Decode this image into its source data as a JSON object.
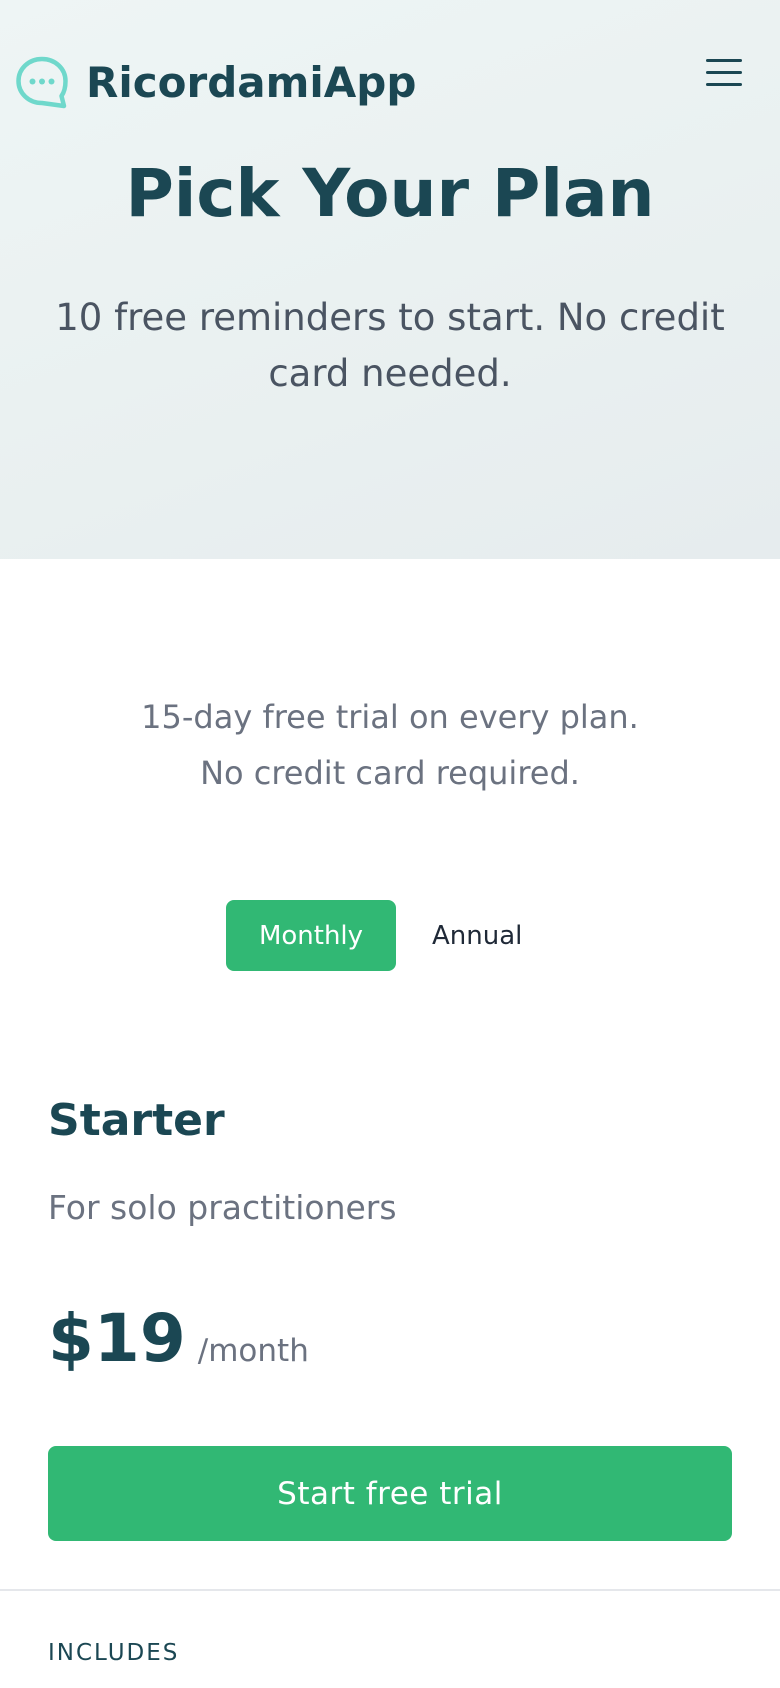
{
  "header": {
    "brand_name": "RicordamiApp",
    "logo_icon": "chat-bubble-icon",
    "menu_icon": "hamburger-menu-icon"
  },
  "hero": {
    "title": "Pick Your Plan",
    "subtitle": "10 free reminders to start. No credit card needed."
  },
  "trial_note": {
    "line1": "15-day free trial on every plan.",
    "line2": "No credit card required."
  },
  "billing_toggle": {
    "options": [
      "Monthly",
      "Annual"
    ],
    "selected": "Monthly"
  },
  "plan": {
    "name": "Starter",
    "description": "For solo practitioners",
    "price": "$19",
    "period": "/month",
    "cta_label": "Start free trial",
    "includes_heading": "INCLUDES"
  },
  "colors": {
    "accent": "#31b874",
    "brand_dark": "#1b4753",
    "logo_teal": "#6fd8cb",
    "muted_text": "#6b7280"
  }
}
